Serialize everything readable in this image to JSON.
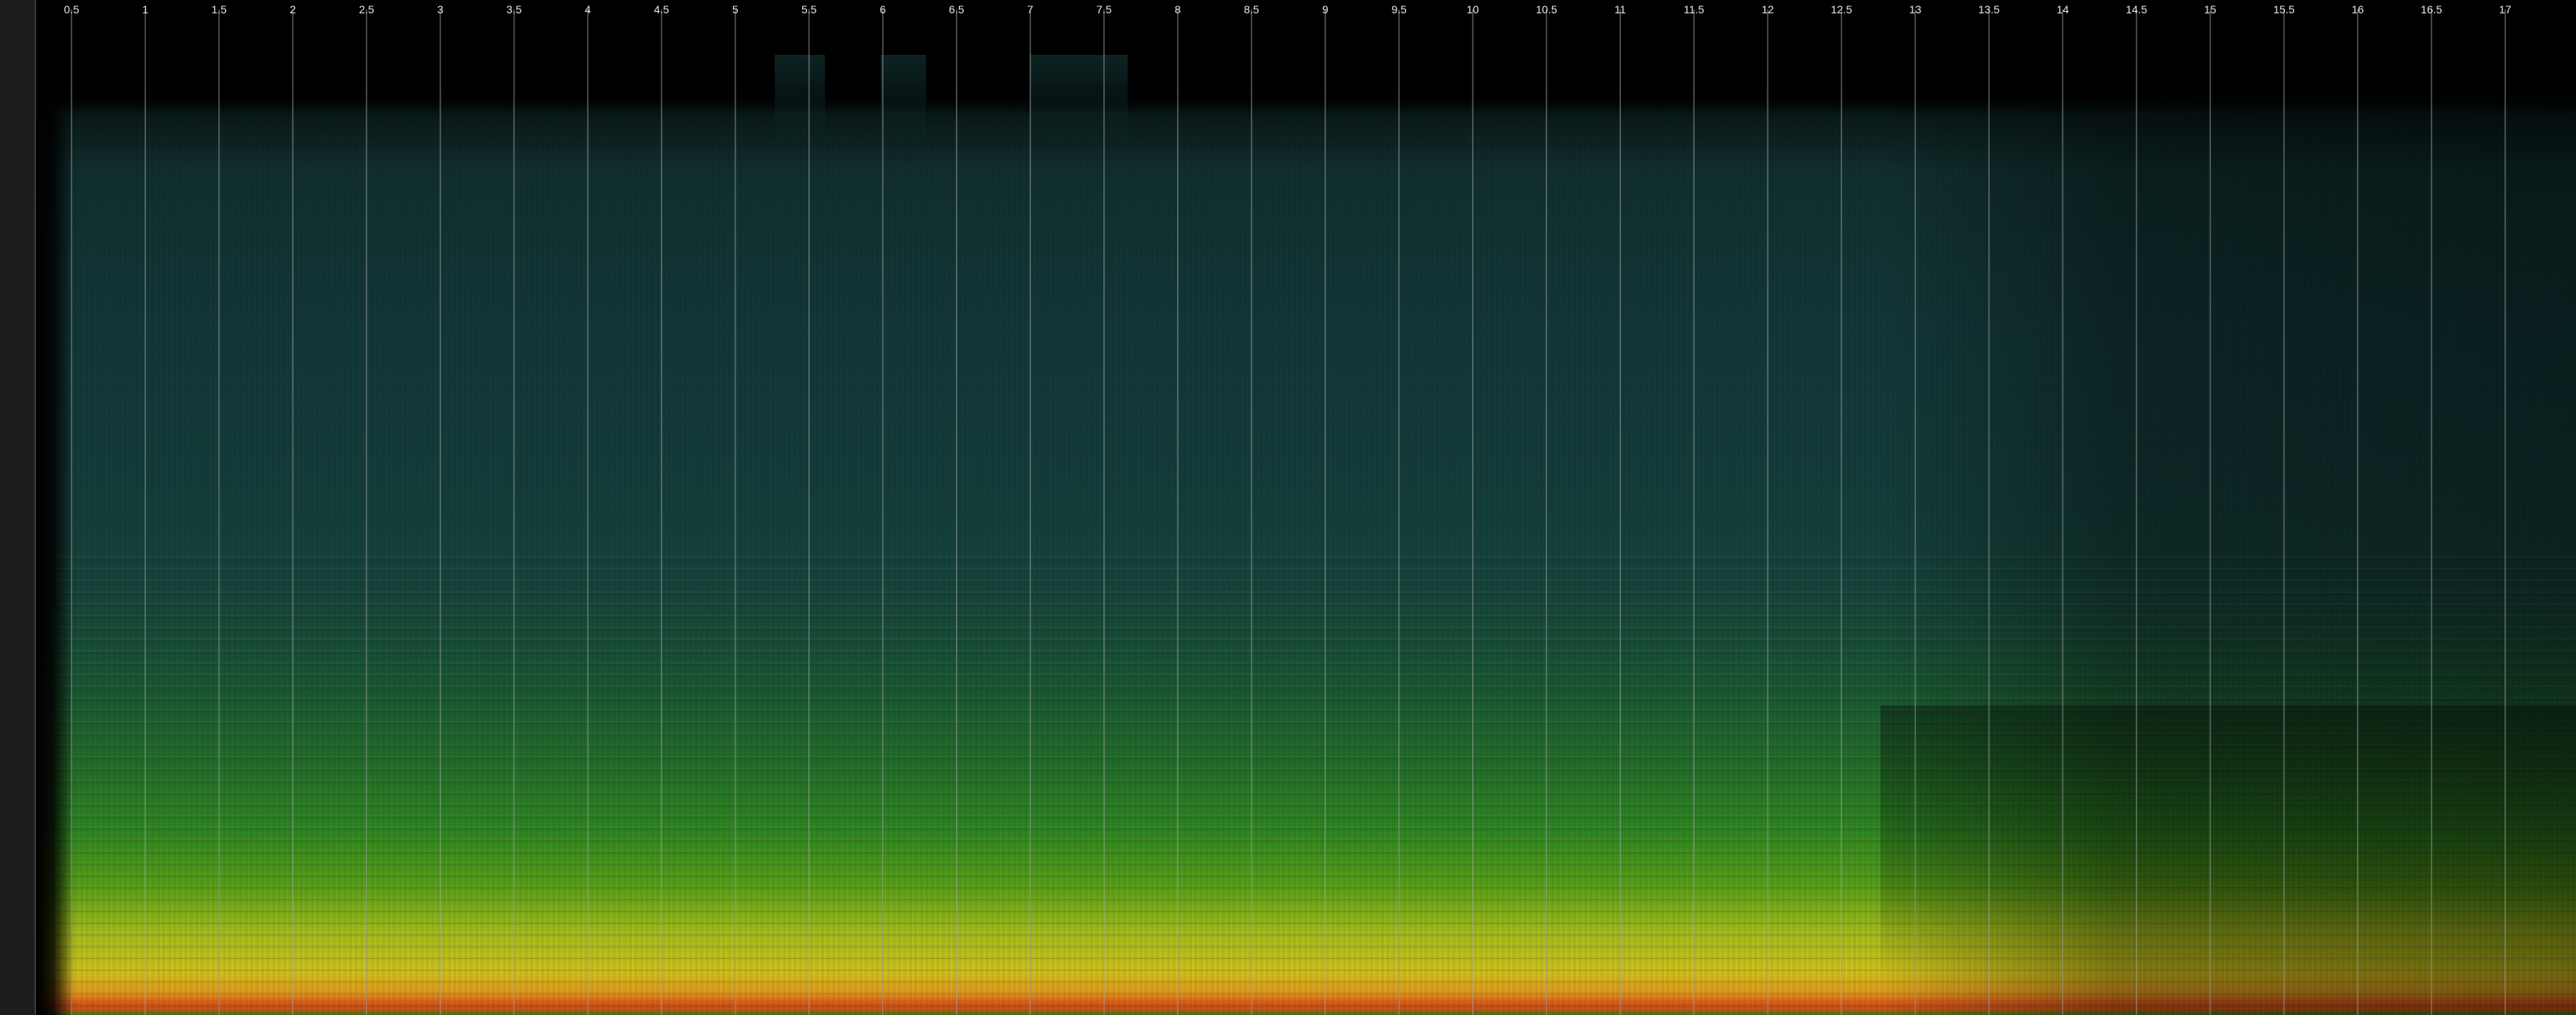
{
  "app": {
    "view": "spectrogram"
  },
  "colors": {
    "background": "#000000",
    "left_panel": "#1d1d1d",
    "grid_line": "#9aa0a0",
    "label": "#e8e8e8",
    "low_energy": "#13393a",
    "mid_energy": "#2f8a22",
    "high_energy": "#d7c81c",
    "peak_energy": "#e2571a"
  },
  "time_axis": {
    "unit_label": "",
    "ticks": [
      {
        "value": 0.5,
        "label": "0.5"
      },
      {
        "value": 1,
        "label": "1"
      },
      {
        "value": 1.5,
        "label": "1.5"
      },
      {
        "value": 2,
        "label": "2"
      },
      {
        "value": 2.5,
        "label": "2.5"
      },
      {
        "value": 3,
        "label": "3"
      },
      {
        "value": 3.5,
        "label": "3.5"
      },
      {
        "value": 4,
        "label": "4"
      },
      {
        "value": 4.5,
        "label": "4.5"
      },
      {
        "value": 5,
        "label": "5"
      },
      {
        "value": 5.5,
        "label": "5.5"
      },
      {
        "value": 6,
        "label": "6"
      },
      {
        "value": 6.5,
        "label": "6.5"
      },
      {
        "value": 7,
        "label": "7"
      },
      {
        "value": 7.5,
        "label": "7.5"
      },
      {
        "value": 8,
        "label": "8"
      },
      {
        "value": 8.5,
        "label": "8.5"
      },
      {
        "value": 9,
        "label": "9"
      },
      {
        "value": 9.5,
        "label": "9.5"
      },
      {
        "value": 10,
        "label": "10"
      },
      {
        "value": 10.5,
        "label": "10.5"
      },
      {
        "value": 11,
        "label": "11"
      },
      {
        "value": 11.5,
        "label": "11.5"
      },
      {
        "value": 12,
        "label": "12"
      },
      {
        "value": 12.5,
        "label": "12.5"
      },
      {
        "value": 13,
        "label": "13"
      },
      {
        "value": 13.5,
        "label": "13.5"
      },
      {
        "value": 14,
        "label": "14"
      },
      {
        "value": 14.5,
        "label": "14.5"
      },
      {
        "value": 15,
        "label": "15"
      },
      {
        "value": 15.5,
        "label": "15.5"
      },
      {
        "value": 16,
        "label": "16"
      },
      {
        "value": 16.5,
        "label": "16.5"
      },
      {
        "value": 17,
        "label": "17"
      }
    ],
    "range": [
      0.27,
      17.48
    ]
  }
}
